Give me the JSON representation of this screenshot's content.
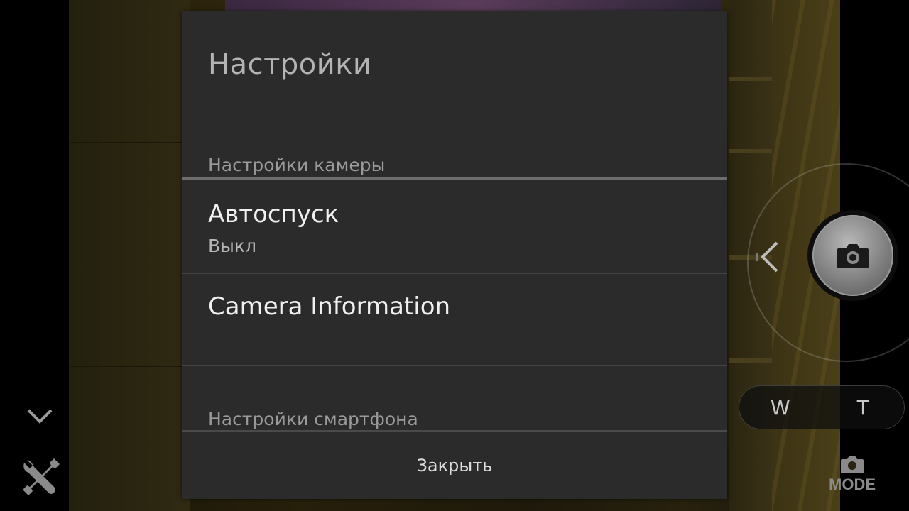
{
  "dialog": {
    "title": "Настройки",
    "sections": [
      {
        "header": "Настройки камеры",
        "items": [
          {
            "title": "Автоспуск",
            "summary": "Выкл"
          },
          {
            "title": "Camera Information"
          }
        ]
      },
      {
        "header": "Настройки смартфона"
      }
    ],
    "close_label": "Закрыть"
  },
  "camera_controls": {
    "zoom": {
      "wide_label": "W",
      "tele_label": "T"
    },
    "mode_label": "MODE",
    "icons": {
      "collapse": "chevron-down-icon",
      "settings": "tools-icon",
      "panel_toggle": "chevron-left-icon",
      "shutter": "camera-icon",
      "mode": "camera-icon"
    }
  },
  "colors": {
    "dialog_background": "#2b2b2b",
    "section_rule": "#6d6d6d",
    "title_text": "#b4b4b4",
    "item_text": "#f0f0f0"
  }
}
